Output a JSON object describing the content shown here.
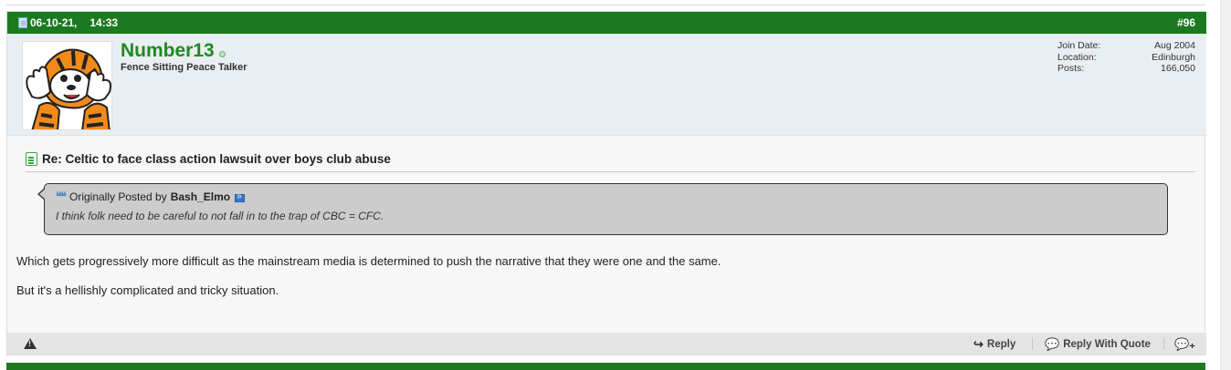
{
  "post": {
    "date": "06-10-21,",
    "time": "14:33",
    "number": "#96",
    "user": {
      "name": "Number13",
      "title": "Fence Sitting Peace Talker",
      "info": [
        {
          "label": "Join Date:",
          "value": "Aug 2004"
        },
        {
          "label": "Location:",
          "value": "Edinburgh"
        },
        {
          "label": "Posts:",
          "value": "166,050"
        }
      ]
    },
    "title": "Re: Celtic to face class action lawsuit over boys club abuse",
    "quote": {
      "prefix": "Originally Posted by",
      "poster": "Bash_Elmo",
      "text": "I think folk need to be careful to not fall in to the trap of CBC = CFC."
    },
    "paragraphs": [
      "Which gets progressively more difficult as the mainstream media is determined to push the narrative that they were one and the same.",
      "But it's a hellishly complicated and tricky situation."
    ],
    "actions": {
      "reply": "Reply",
      "reply_with_quote": "Reply With Quote"
    }
  }
}
